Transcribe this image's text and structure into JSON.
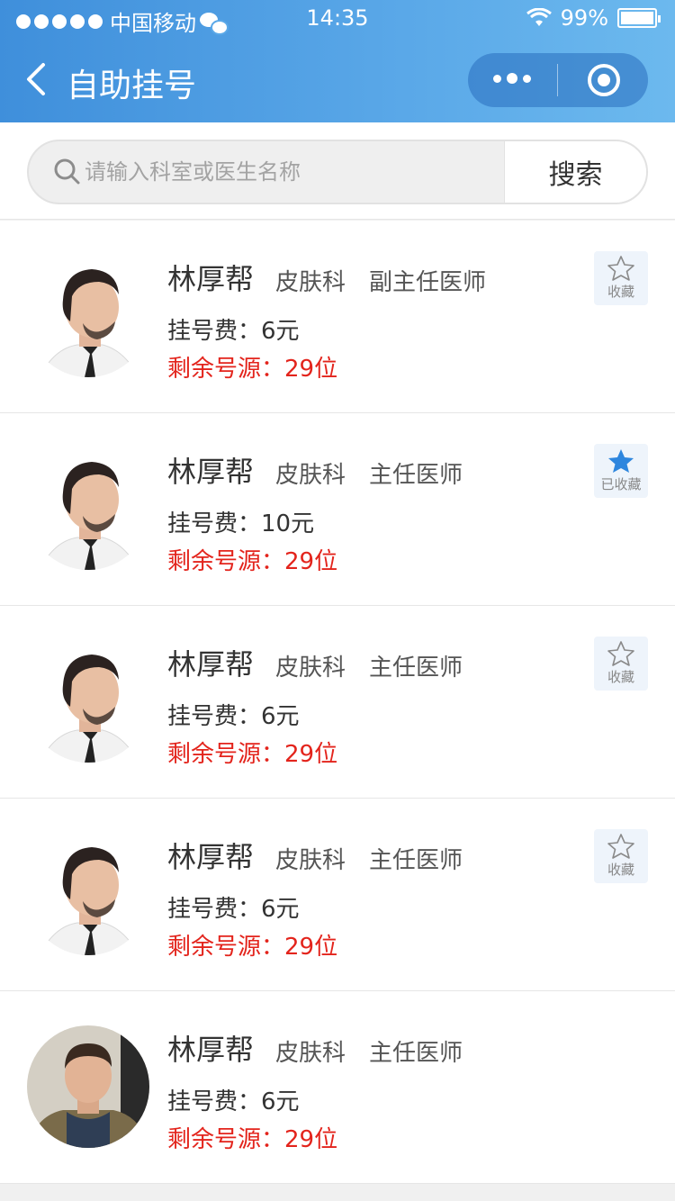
{
  "status_bar": {
    "carrier": "中国移动",
    "time": "14:35",
    "battery": "99%"
  },
  "nav": {
    "title": "自助挂号"
  },
  "search": {
    "placeholder": "请输入科室或医生名称",
    "value": "",
    "button_label": "搜索"
  },
  "colors": {
    "accent": "#4a9be2",
    "remain": "#e3241c",
    "fav_active": "#2e86de"
  },
  "doctors": [
    {
      "name": "林厚帮",
      "dept": "皮肤科",
      "title": "副主任医师",
      "fee": "挂号费：6元",
      "remain": "剩余号源：29位",
      "fav_label": "收藏",
      "favorited": false,
      "avatar": "man-beard"
    },
    {
      "name": "林厚帮",
      "dept": "皮肤科",
      "title": "主任医师",
      "fee": "挂号费：10元",
      "remain": "剩余号源：29位",
      "fav_label": "已收藏",
      "favorited": true,
      "avatar": "man-beard"
    },
    {
      "name": "林厚帮",
      "dept": "皮肤科",
      "title": "主任医师",
      "fee": "挂号费：6元",
      "remain": "剩余号源：29位",
      "fav_label": "收藏",
      "favorited": false,
      "avatar": "man-beard"
    },
    {
      "name": "林厚帮",
      "dept": "皮肤科",
      "title": "主任医师",
      "fee": "挂号费：6元",
      "remain": "剩余号源：29位",
      "fav_label": "收藏",
      "favorited": false,
      "avatar": "man-beard"
    },
    {
      "name": "林厚帮",
      "dept": "皮肤科",
      "title": "主任医师",
      "fee": "挂号费：6元",
      "remain": "剩余号源：29位",
      "fav_label": "",
      "favorited": false,
      "avatar": "young-man"
    }
  ]
}
